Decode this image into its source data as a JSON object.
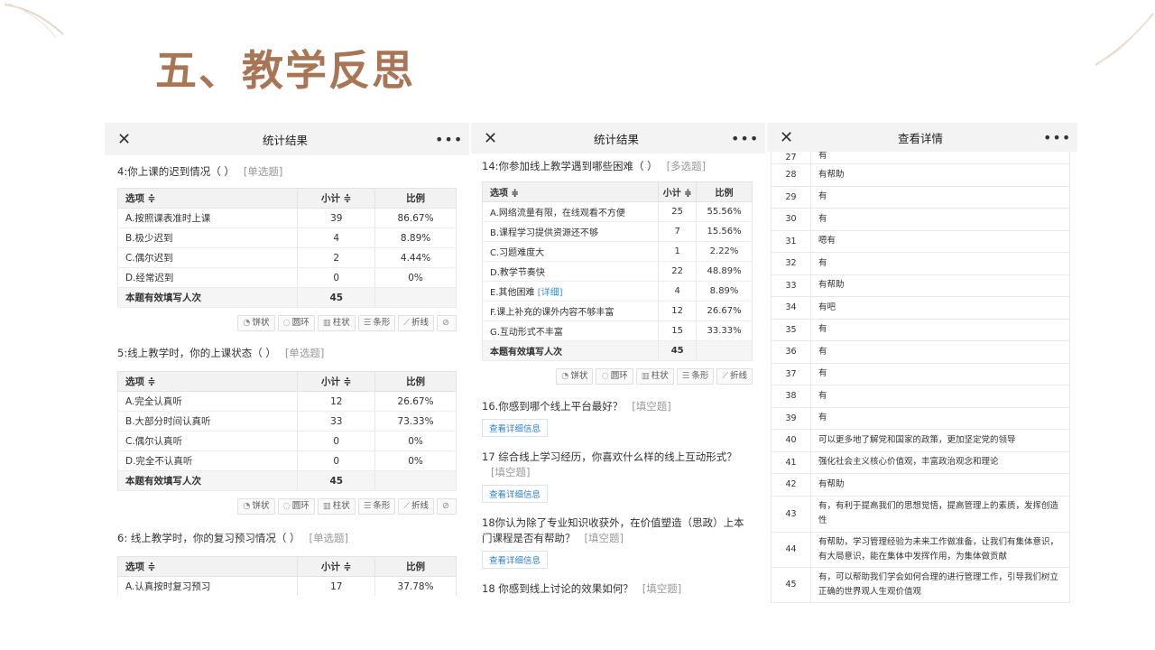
{
  "slide": {
    "title": "五、教学反思"
  },
  "panel1": {
    "header": {
      "title": "统计结果"
    },
    "q4": {
      "title": "4:你上课的迟到情况（ ）",
      "tag": "[单选题]",
      "headers": [
        "选项 ≑",
        "小计 ≑",
        "比例"
      ],
      "rows": [
        {
          "opt": "A.按照课表准时上课",
          "n": "39",
          "pct": "86.67%"
        },
        {
          "opt": "B.极少迟到",
          "n": "4",
          "pct": "8.89%"
        },
        {
          "opt": "C.偶尔迟到",
          "n": "2",
          "pct": "4.44%"
        },
        {
          "opt": "D.经常迟到",
          "n": "0",
          "pct": "0%"
        }
      ],
      "total": {
        "label": "本题有效填写人次",
        "n": "45"
      }
    },
    "q5": {
      "title": "5:线上教学时，你的上课状态（ ）",
      "tag": "[单选题]",
      "headers": [
        "选项 ≑",
        "小计 ≑",
        "比例"
      ],
      "rows": [
        {
          "opt": "A.完全认真听",
          "n": "12",
          "pct": "26.67%"
        },
        {
          "opt": "B.大部分时间认真听",
          "n": "33",
          "pct": "73.33%"
        },
        {
          "opt": "C.偶尔认真听",
          "n": "0",
          "pct": "0%"
        },
        {
          "opt": "D.完全不认真听",
          "n": "0",
          "pct": "0%"
        }
      ],
      "total": {
        "label": "本题有效填写人次",
        "n": "45"
      }
    },
    "q6": {
      "title": "6: 线上教学时，你的复习预习情况（ ）",
      "tag": "[单选题]",
      "headers": [
        "选项 ≑",
        "小计 ≑",
        "比例"
      ],
      "rows": [
        {
          "opt": "A.认真按时复习预习",
          "n": "17",
          "pct": "37.78%"
        }
      ]
    },
    "chart_buttons": [
      "饼状",
      "圆环",
      "柱状",
      "条形",
      "折线"
    ]
  },
  "panel2": {
    "header": {
      "title": "统计结果"
    },
    "q14": {
      "title": "14:你参加线上教学遇到哪些困难（ ）",
      "tag": "[多选题]",
      "headers": [
        "选项 ≑",
        "小计 ≑",
        "比例"
      ],
      "rows": [
        {
          "opt": "A.网络流量有限，在线观看不方便",
          "n": "25",
          "pct": "55.56%"
        },
        {
          "opt": "B.课程学习提供资源还不够",
          "n": "7",
          "pct": "15.56%"
        },
        {
          "opt": "C.习题难度大",
          "n": "1",
          "pct": "2.22%"
        },
        {
          "opt": "D.教学节奏快",
          "n": "22",
          "pct": "48.89%"
        },
        {
          "opt": "E.其他困难",
          "n": "4",
          "pct": "8.89%"
        },
        {
          "opt": "F.课上补充的课外内容不够丰富",
          "n": "12",
          "pct": "26.67%"
        },
        {
          "opt": "G.互动形式不丰富",
          "n": "15",
          "pct": "33.33%"
        }
      ],
      "detail_link": "[详细]",
      "total": {
        "label": "本题有效填写人次",
        "n": "45"
      }
    },
    "chart_buttons": [
      "饼状",
      "圆环",
      "柱状",
      "条形",
      "折线"
    ],
    "q16": {
      "title": "16.你感到哪个线上平台最好？",
      "tag": "[填空题]",
      "btn": "查看详细信息"
    },
    "q17": {
      "title": "17 综合线上学习经历，你喜欢什么样的线上互动形式？",
      "tag": "[填空题]",
      "btn": "查看详细信息"
    },
    "q18a": {
      "title": "18你认为除了专业知识收获外，在价值塑造（思政）上本门课程是否有帮助？",
      "tag": "[填空题]",
      "btn": "查看详细信息"
    },
    "q18b": {
      "title": "18 你感到线上讨论的效果如何？",
      "tag": "[填空题]"
    }
  },
  "panel3": {
    "header": {
      "title": "查看详情"
    },
    "rows": [
      {
        "n": "27",
        "t": "有"
      },
      {
        "n": "28",
        "t": "有帮助"
      },
      {
        "n": "29",
        "t": "有"
      },
      {
        "n": "30",
        "t": "有"
      },
      {
        "n": "31",
        "t": "嗯有"
      },
      {
        "n": "32",
        "t": "有"
      },
      {
        "n": "33",
        "t": "有帮助"
      },
      {
        "n": "34",
        "t": "有吧"
      },
      {
        "n": "35",
        "t": "有"
      },
      {
        "n": "36",
        "t": "有"
      },
      {
        "n": "37",
        "t": "有"
      },
      {
        "n": "38",
        "t": "有"
      },
      {
        "n": "39",
        "t": "有"
      },
      {
        "n": "40",
        "t": "可以更多地了解党和国家的政策，更加坚定党的领导"
      },
      {
        "n": "41",
        "t": "强化社会主义核心价值观，丰富政治观念和理论"
      },
      {
        "n": "42",
        "t": "有帮助"
      },
      {
        "n": "43",
        "t": "有，有利于提高我们的思想觉悟，提高管理上的素质，发挥创造性"
      },
      {
        "n": "44",
        "t": "有帮助，学习管理经验为未来工作做准备，让我们有集体意识，有大局意识，能在集体中发挥作用，为集体做贡献"
      },
      {
        "n": "45",
        "t": "有，可以帮助我们学会如何合理的进行管理工作，引导我们树立正确的世界观人生观价值观"
      }
    ]
  }
}
